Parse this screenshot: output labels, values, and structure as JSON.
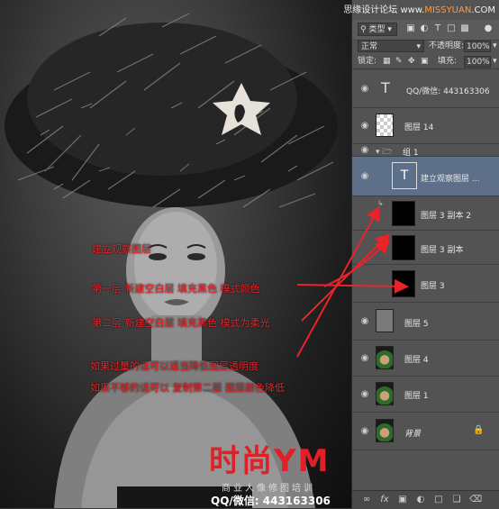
{
  "watermark": {
    "site_cn": "思缘设计论坛",
    "site_url_a": "www.",
    "site_url_b": "MISSYUAN",
    "site_url_c": ".COM"
  },
  "annotations": [
    "建立观察图层",
    "第一层  新建空白层  填充黑色  模式颜色",
    "第二层  新建空白层  填充黑色  模式为柔光",
    "如果过量的话可以适当降低图层透明度",
    "如果不够的话可以  复制第二层  图层颜色降低"
  ],
  "brand": {
    "logo_text": "时尚YM",
    "tagline": "商业人像修图培训",
    "qq": "QQ/微信: 443163306"
  },
  "panel": {
    "filter_label": "类型",
    "filter_icons": [
      "image-filter-icon",
      "adjustment-filter-icon",
      "text-filter-icon",
      "shape-filter-icon",
      "smart-object-filter-icon"
    ],
    "blend_mode": "正常",
    "opacity_label": "不透明度:",
    "opacity_value": "100%",
    "lock_label": "锁定:",
    "fill_label": "填充:",
    "fill_value": "100%"
  },
  "layers": [
    {
      "name": "QQ/微信: 443163306",
      "kind": "text"
    },
    {
      "name": "图层 14",
      "kind": "transparent"
    },
    {
      "name": "组 1",
      "kind": "group"
    },
    {
      "name": "建立观察图层 ...",
      "kind": "text-selected"
    },
    {
      "name": "图层 3 副本 2",
      "kind": "black"
    },
    {
      "name": "图层 3 副本",
      "kind": "black"
    },
    {
      "name": "图层 3",
      "kind": "black"
    },
    {
      "name": "图层 5",
      "kind": "gray"
    },
    {
      "name": "图层 4",
      "kind": "photo"
    },
    {
      "name": "图层 1",
      "kind": "photo"
    },
    {
      "name": "背景",
      "kind": "photo-locked"
    }
  ],
  "colors": {
    "annotation_red": "#e8242a",
    "panel_bg": "#535353",
    "selected_row": "#5d6f89"
  }
}
